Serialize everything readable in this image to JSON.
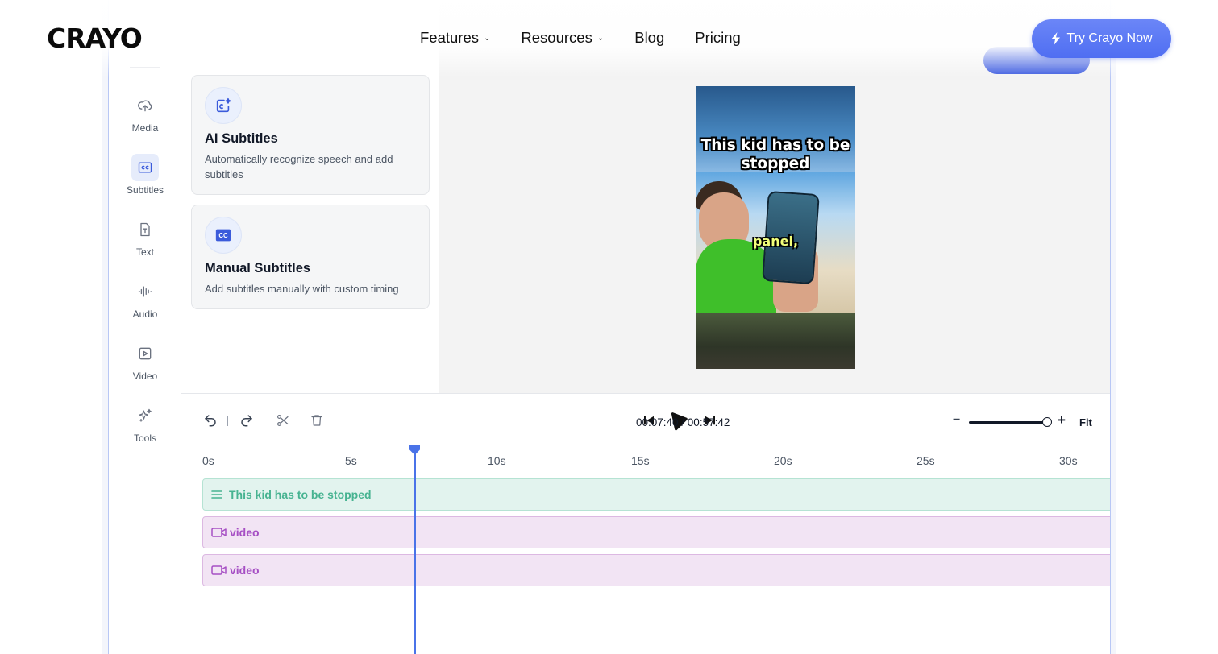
{
  "nav": {
    "logo": "CRAYO",
    "links": [
      {
        "label": "Features",
        "has_dropdown": true
      },
      {
        "label": "Resources",
        "has_dropdown": true
      },
      {
        "label": "Blog",
        "has_dropdown": false
      },
      {
        "label": "Pricing",
        "has_dropdown": false
      }
    ],
    "cta_label": "Try Crayo Now",
    "cta_icon": "bolt-icon",
    "accent": "#4f6ef2"
  },
  "rail": {
    "items": [
      {
        "label": "Media",
        "icon": "cloud-upload-icon",
        "active": false
      },
      {
        "label": "Subtitles",
        "icon": "cc-icon",
        "active": true
      },
      {
        "label": "Text",
        "icon": "text-icon",
        "active": false
      },
      {
        "label": "Audio",
        "icon": "audio-wave-icon",
        "active": false
      },
      {
        "label": "Video",
        "icon": "video-play-icon",
        "active": false
      },
      {
        "label": "Tools",
        "icon": "sparkle-icon",
        "active": false
      }
    ]
  },
  "panel": {
    "cards": [
      {
        "title": "AI Subtitles",
        "description": "Automatically recognize speech and add subtitles",
        "icon": "ai-sparkle-box-icon"
      },
      {
        "title": "Manual Subtitles",
        "description": "Add subtitles manually with custom timing",
        "icon": "cc-filled-icon"
      }
    ]
  },
  "preview": {
    "caption_main": "This kid has to be stopped",
    "caption_word": "panel,"
  },
  "controls": {
    "current_time": "00:07:40",
    "total_time": "00:57:42",
    "time_display": "00:07:40 / 00:57:42",
    "zoom_fit_label": "Fit",
    "zoom_level": 1.0
  },
  "timeline": {
    "ruler": [
      "0s",
      "5s",
      "10s",
      "15s",
      "20s",
      "25s",
      "30s"
    ],
    "playhead_seconds": 7.4,
    "tracks": [
      {
        "type": "subtitle",
        "label": "This kid has to be stopped",
        "icon": "lines-icon"
      },
      {
        "type": "video",
        "label": "video",
        "icon": "video-camera-icon"
      },
      {
        "type": "video",
        "label": "video",
        "icon": "video-camera-icon"
      }
    ]
  }
}
